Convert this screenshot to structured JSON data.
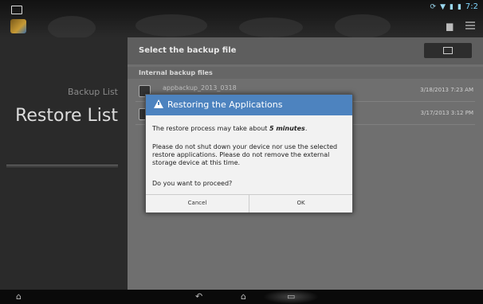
{
  "status_bar": {
    "time": "7:2"
  },
  "left_panel": {
    "backup_list": "Backup List",
    "restore_list": "Restore List"
  },
  "right_panel": {
    "header_title": "Select the backup file",
    "section_label": "Internal backup files",
    "files": [
      {
        "name": "appbackup_2013_0318",
        "date": "3/18/2013 7:23 AM"
      },
      {
        "name": "",
        "date": "3/17/2013 3:12 PM"
      }
    ]
  },
  "dialog": {
    "title": "Restoring the Applications",
    "line1_prefix": "The restore process may take about ",
    "line1_emph": "5 minutes",
    "line1_suffix": ".",
    "line2": "Please do not shut down your device nor use the selected restore applications. Please do not remove the external storage device at this time.",
    "line3": "Do you want to proceed?",
    "cancel": "Cancel",
    "ok": "OK"
  },
  "icons": [
    "notification-icon",
    "app-icon",
    "gallery-icon",
    "menu-icon",
    "folder-icon",
    "warning-icon",
    "home-icon",
    "back-icon",
    "recent-apps-icon",
    "screenshot-icon"
  ]
}
